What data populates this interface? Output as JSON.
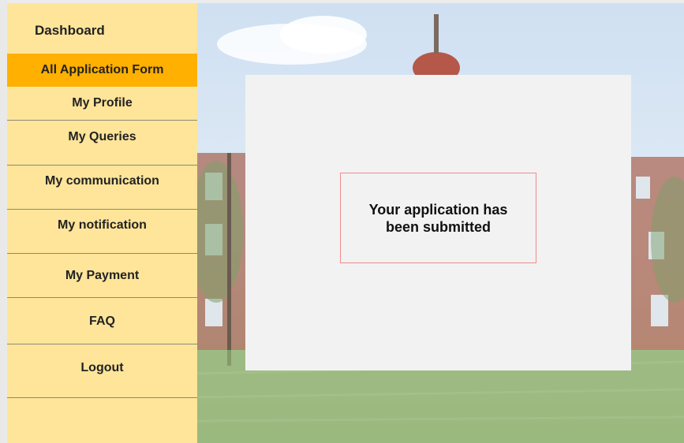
{
  "sidebar": {
    "dashboard_label": "Dashboard",
    "items": [
      {
        "label": "All Application Form",
        "active": true
      },
      {
        "label": "My Profile"
      },
      {
        "label": "My Queries"
      },
      {
        "label": "My communication"
      },
      {
        "label": "My notification"
      },
      {
        "label": "My Payment"
      },
      {
        "label": "FAQ"
      },
      {
        "label": "Logout"
      }
    ]
  },
  "main": {
    "message": "Your application has been submitted"
  },
  "colors": {
    "sidebar_bg": "#ffe59a",
    "active_item_bg": "#ffb000",
    "card_bg": "#f2f2f2",
    "message_border": "#f08a8a"
  }
}
